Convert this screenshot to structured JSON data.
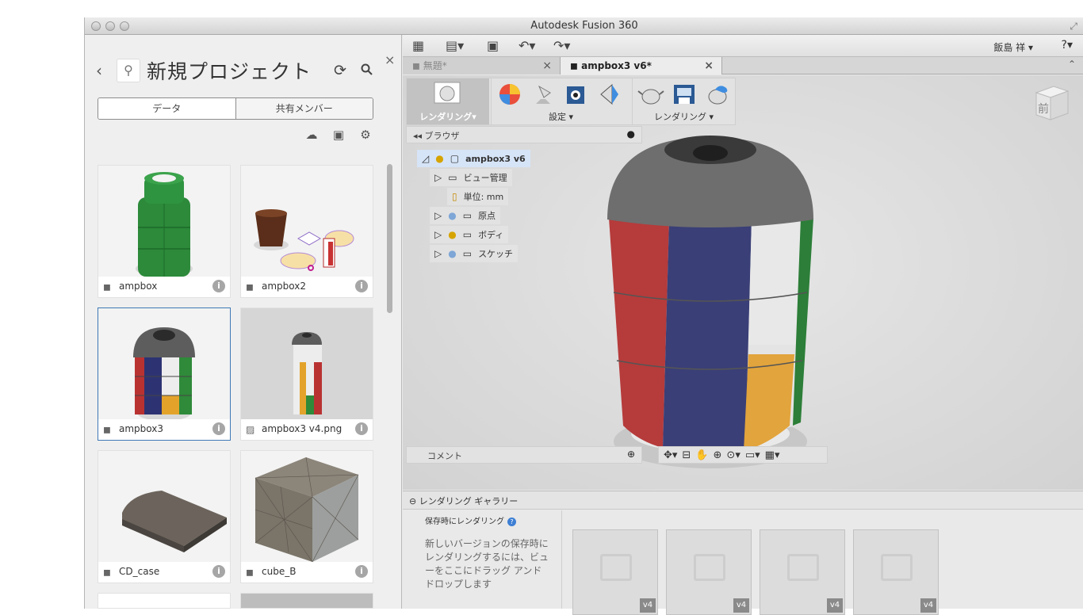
{
  "window": {
    "title": "Autodesk Fusion 360"
  },
  "left_panel": {
    "project_title": "新規プロジェクト",
    "segments": {
      "data": "データ",
      "members": "共有メンバー"
    },
    "items": [
      {
        "name": "ampbox",
        "type": "design"
      },
      {
        "name": "ampbox2",
        "type": "design"
      },
      {
        "name": "ampbox3",
        "type": "design",
        "selected": true
      },
      {
        "name": "ampbox3 v4.png",
        "type": "image"
      },
      {
        "name": "CD_case",
        "type": "design"
      },
      {
        "name": "cube_B",
        "type": "design"
      }
    ]
  },
  "header": {
    "user": "飯島 祥 ▾",
    "help": "?▾"
  },
  "tabs": [
    {
      "label": "無題*"
    },
    {
      "label": "ampbox3 v6*"
    }
  ],
  "toolbar": {
    "group1_label": "レンダリング▾",
    "group2_label": "設定 ▾",
    "group3_label": "レンダリング ▾"
  },
  "browser": {
    "label": "ブラウザ",
    "root": "ampbox3 v6",
    "nodes": [
      "ビュー管理",
      "単位: mm",
      "原点",
      "ボディ",
      "スケッチ"
    ]
  },
  "viewcube": {
    "face": "前"
  },
  "comment": {
    "label": "コメント"
  },
  "gallery": {
    "title": "レンダリング ギャラリー",
    "subtitle": "保存時にレンダリング",
    "description": "新しいバージョンの保存時にレンダリングするには、ビューをここにドラッグ アンド ドロップします",
    "versions": [
      "v4",
      "v4",
      "v4",
      "v4"
    ]
  },
  "colors": {
    "selection": "#3f79b6",
    "help_blue": "#3d7fd4"
  },
  "icons": [
    "back-chevron-icon",
    "refresh-icon",
    "search-icon",
    "close-icon",
    "upload-icon",
    "new-folder-icon",
    "gear-icon",
    "info-icon",
    "grid-icon",
    "file-icon",
    "save-icon",
    "undo-icon",
    "redo-icon",
    "bulb-icon",
    "folder-icon",
    "orbit-icon",
    "pan-icon",
    "zoom-icon"
  ]
}
